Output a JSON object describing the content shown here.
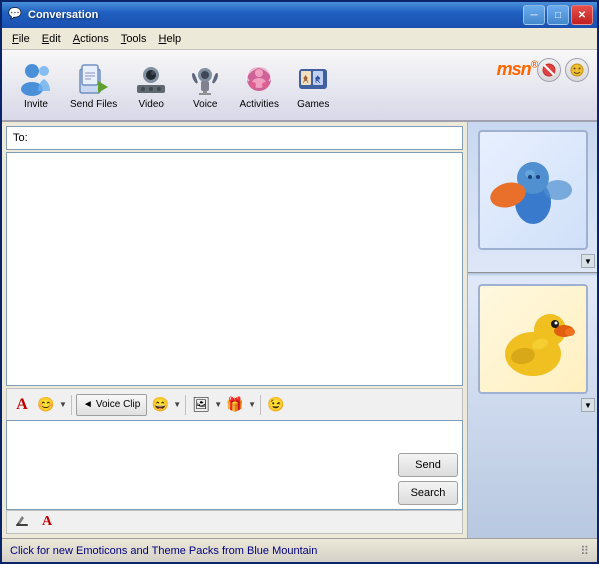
{
  "window": {
    "title": "Conversation",
    "title_icon": "💬"
  },
  "titlebar": {
    "minimize_label": "─",
    "maximize_label": "□",
    "close_label": "✕"
  },
  "menubar": {
    "items": [
      {
        "id": "file",
        "label": "File"
      },
      {
        "id": "edit",
        "label": "Edit"
      },
      {
        "id": "actions",
        "label": "Actions"
      },
      {
        "id": "tools",
        "label": "Tools"
      },
      {
        "id": "help",
        "label": "Help"
      }
    ]
  },
  "toolbar": {
    "buttons": [
      {
        "id": "invite",
        "label": "Invite",
        "icon": "👤"
      },
      {
        "id": "send-files",
        "label": "Send Files",
        "icon": "📁"
      },
      {
        "id": "video",
        "label": "Video",
        "icon": "📷"
      },
      {
        "id": "voice",
        "label": "Voice",
        "icon": "🎤"
      },
      {
        "id": "activities",
        "label": "Activities",
        "icon": "🎵"
      },
      {
        "id": "games",
        "label": "Games",
        "icon": "🃏"
      }
    ],
    "msn_logo": "msn",
    "block_btn_icon": "🚫",
    "emoticon_btn_icon": "😊"
  },
  "chat": {
    "to_label": "To:",
    "to_value": ""
  },
  "format_toolbar": {
    "font_btn": "A",
    "emoticon_btn": "😊",
    "emoticon_arrow": "▼",
    "voice_clip_label": "Voice Clip",
    "voice_icon": "◄",
    "nudge_btn": "😄",
    "nudge_arrow": "▼",
    "image_btn": "🖼",
    "image_arrow": "▼",
    "gift_btn": "🎁",
    "gift_arrow": "▼",
    "wink_btn": "😉"
  },
  "send_buttons": {
    "send_label": "Send",
    "search_label": "Search"
  },
  "bottom_format_bar": {
    "handwriting_icon": "✏",
    "font_icon": "A"
  },
  "status_bar": {
    "text": "Click for new Emoticons and Theme Packs from Blue Mountain"
  },
  "avatars": {
    "top": "MSN Butterfly Avatar",
    "bottom": "Yellow Duck Avatar"
  }
}
